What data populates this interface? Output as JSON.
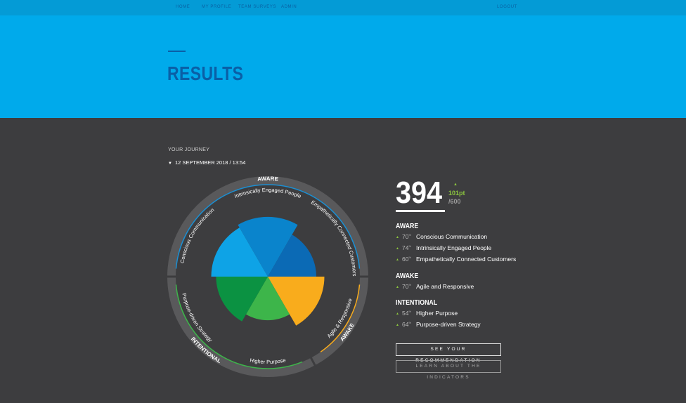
{
  "nav": {
    "items": [
      {
        "label": "HOME"
      },
      {
        "label": "MY PROFILE"
      },
      {
        "label": "TEAM SURVEYS"
      },
      {
        "label": "ADMIN"
      }
    ],
    "logout": "LOGOUT"
  },
  "hero": {
    "title": "RESULTS"
  },
  "journey": {
    "label": "YOUR JOURNEY",
    "date": "12 SEPTEMBER 2018 / 13:54"
  },
  "score": {
    "value": "394",
    "delta": "101pt",
    "max": "/600"
  },
  "groups": [
    {
      "title": "AWARE",
      "indicators": [
        {
          "pct": "70",
          "label": "Conscious Communication"
        },
        {
          "pct": "74",
          "label": "Intrinsically Engaged People"
        },
        {
          "pct": "60",
          "label": "Empathetically Connected Customers"
        }
      ]
    },
    {
      "title": "AWAKE",
      "indicators": [
        {
          "pct": "70",
          "label": "Agile and Responsive"
        }
      ]
    },
    {
      "title": "INTENTIONAL",
      "indicators": [
        {
          "pct": "54",
          "label": "Higher Purpose"
        },
        {
          "pct": "64",
          "label": "Purpose-driven Strategy"
        }
      ]
    }
  ],
  "pct_suffix": "%",
  "buttons": {
    "recommendation": "SEE YOUR RECOMMENDATION",
    "indicators": "LEARN ABOUT THE INDICATORS"
  },
  "wheel": {
    "segments": [
      {
        "label": "Intrinsically Engaged People",
        "value": 74,
        "color": "#0a84cc"
      },
      {
        "label": "Empathetically Connected Customers",
        "value": 60,
        "color": "#0b6ab5"
      },
      {
        "label": "Agile & Responsive",
        "value": 70,
        "color": "#f9ac1c"
      },
      {
        "label": "Higher Purpose",
        "value": 54,
        "color": "#3db54a"
      },
      {
        "label": "Purpose-driven Strategy",
        "value": 64,
        "color": "#0b9242"
      },
      {
        "label": "Conscious Communication",
        "value": 70,
        "color": "#0ea3e6"
      }
    ],
    "groups": [
      {
        "label": "AWARE",
        "color": "#1b8fd3"
      },
      {
        "label": "AWAKE",
        "color": "#f9ac1c"
      },
      {
        "label": "INTENTIONAL",
        "color": "#3db54a"
      }
    ]
  },
  "colors": {
    "nav_bg": "#049bd6",
    "hero_bg": "#00aaeb",
    "title": "#0a5fa6",
    "content_bg": "#3d3d3f",
    "positive": "#8cc63f"
  }
}
